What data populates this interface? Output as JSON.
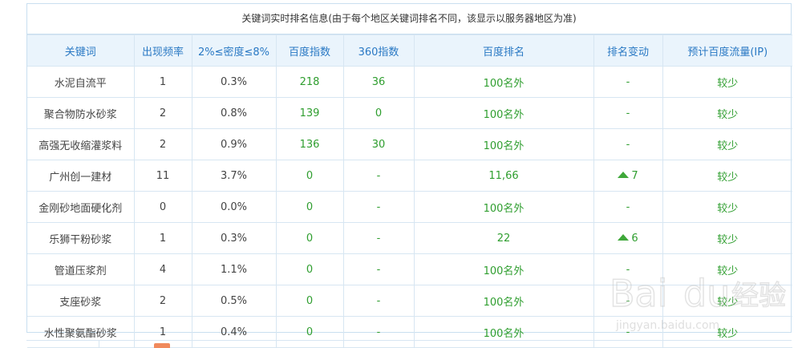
{
  "caption": "关键词实时排名信息(由于每个地区关键词排名不同，该显示以服务器地区为准)",
  "headers": [
    "关键词",
    "出现频率",
    "2%≤密度≤8%",
    "百度指数",
    "360指数",
    "百度排名",
    "排名变动",
    "预计百度流量(IP)"
  ],
  "rows": [
    {
      "keyword": "水泥自流平",
      "freq": "1",
      "density": "0.3%",
      "baidu_index": "218",
      "index360": "36",
      "rank": "100名外",
      "change": "-",
      "change_up": false,
      "traffic": "较少"
    },
    {
      "keyword": "聚合物防水砂浆",
      "freq": "2",
      "density": "0.8%",
      "baidu_index": "139",
      "index360": "0",
      "rank": "100名外",
      "change": "-",
      "change_up": false,
      "traffic": "较少"
    },
    {
      "keyword": "高强无收缩灌浆料",
      "freq": "2",
      "density": "0.9%",
      "baidu_index": "136",
      "index360": "30",
      "rank": "100名外",
      "change": "-",
      "change_up": false,
      "traffic": "较少"
    },
    {
      "keyword": "广州创一建材",
      "freq": "11",
      "density": "3.7%",
      "baidu_index": "0",
      "index360": "-",
      "rank": "11,66",
      "change": "7",
      "change_up": true,
      "traffic": "较少"
    },
    {
      "keyword": "金刚砂地面硬化剂",
      "freq": "0",
      "density": "0.0%",
      "baidu_index": "0",
      "index360": "-",
      "rank": "100名外",
      "change": "-",
      "change_up": false,
      "traffic": "较少"
    },
    {
      "keyword": "乐狮干粉砂浆",
      "freq": "1",
      "density": "0.3%",
      "baidu_index": "0",
      "index360": "-",
      "rank": "22",
      "change": "6",
      "change_up": true,
      "traffic": "较少"
    },
    {
      "keyword": "管道压浆剂",
      "freq": "4",
      "density": "1.1%",
      "baidu_index": "0",
      "index360": "-",
      "rank": "100名外",
      "change": "-",
      "change_up": false,
      "traffic": "较少"
    },
    {
      "keyword": "支座砂浆",
      "freq": "2",
      "density": "0.5%",
      "baidu_index": "0",
      "index360": "-",
      "rank": "100名外",
      "change": "-",
      "change_up": false,
      "traffic": "较少"
    },
    {
      "keyword": "水性聚氨酯砂浆",
      "freq": "1",
      "density": "0.4%",
      "baidu_index": "0",
      "index360": "-",
      "rank": "100名外",
      "change": "-",
      "change_up": false,
      "traffic": "较少"
    }
  ],
  "watermark": {
    "brand": "Bai",
    "brand2": "du",
    "cn": "经验",
    "url": "jingyan.baidu.com"
  },
  "colors": {
    "header_text": "#2a79c4",
    "header_bg": "#eaf4fc",
    "value_green": "#2f9e2f",
    "arrow_green": "#3fa83a",
    "border": "#d7e6f2"
  }
}
